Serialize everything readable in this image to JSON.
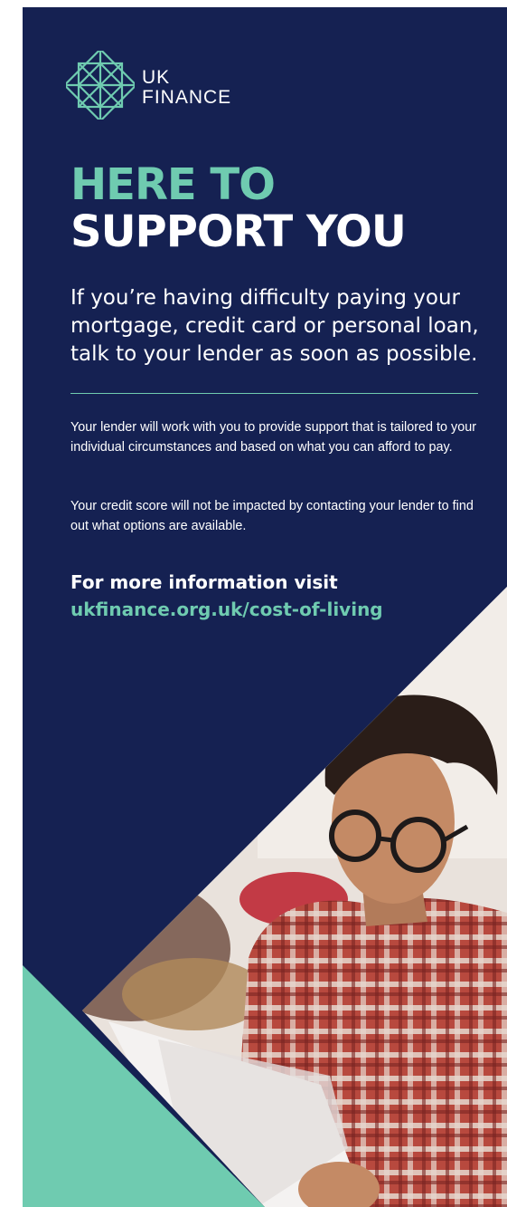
{
  "brand": {
    "logo_line1": "UK",
    "logo_line2": "FINANCE"
  },
  "headline": {
    "line1": "HERE TO",
    "line2": "SUPPORT YOU"
  },
  "lead": "If you’re having difficulty paying your mortgage, credit card or personal loan, talk to your lender as soon as possible.",
  "body": {
    "paragraph1": "Your lender will work with you to provide support that is tailored to your individual circumstances and based on what you can afford to pay.",
    "paragraph2": "Your credit score will not be impacted by contacting your lender to find out what options are available."
  },
  "cta": {
    "label": "For more information visit",
    "link": "ukfinance.org.uk/cost-of-living"
  },
  "colors": {
    "navy": "#152152",
    "teal": "#6fcbb0",
    "text": "#ffffff"
  }
}
